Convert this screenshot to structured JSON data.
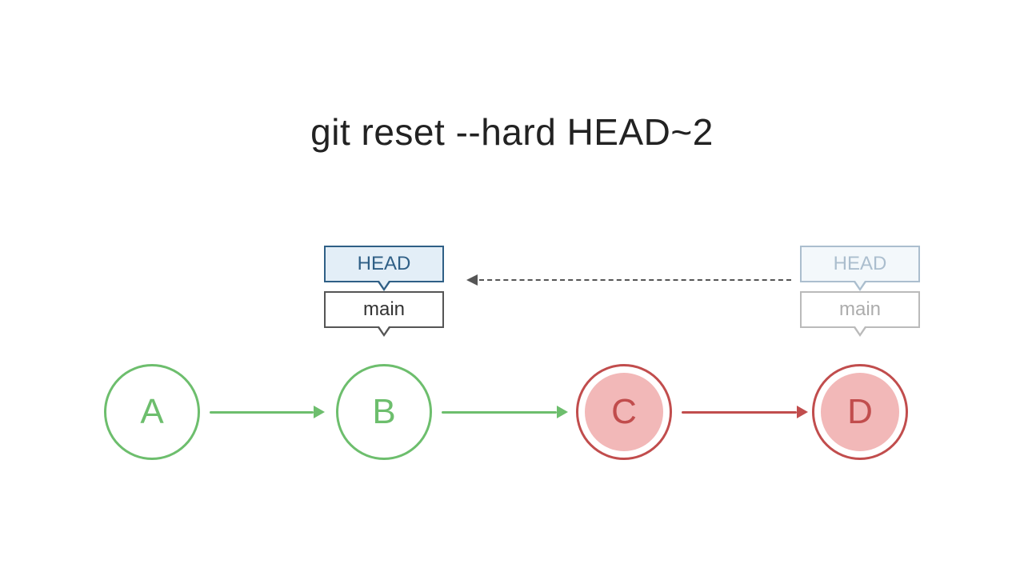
{
  "title": "git reset --hard HEAD~2",
  "commits": {
    "a": "A",
    "b": "B",
    "c": "C",
    "d": "D"
  },
  "pointers": {
    "head_current": "HEAD",
    "main_current": "main",
    "head_previous": "HEAD",
    "main_previous": "main"
  },
  "colors": {
    "kept": "#6DBE6D",
    "removed": "#C14D4D",
    "removed_fill": "#F2B8B8",
    "head_border": "#2F5F86",
    "head_fill": "#E3EEF7",
    "dash": "#555555"
  },
  "semantics": {
    "kept_commits": [
      "A",
      "B"
    ],
    "removed_commits": [
      "C",
      "D"
    ],
    "head_moves_from": "D",
    "head_moves_to": "B",
    "branch": "main",
    "reset_distance": 2,
    "reset_mode": "hard"
  }
}
